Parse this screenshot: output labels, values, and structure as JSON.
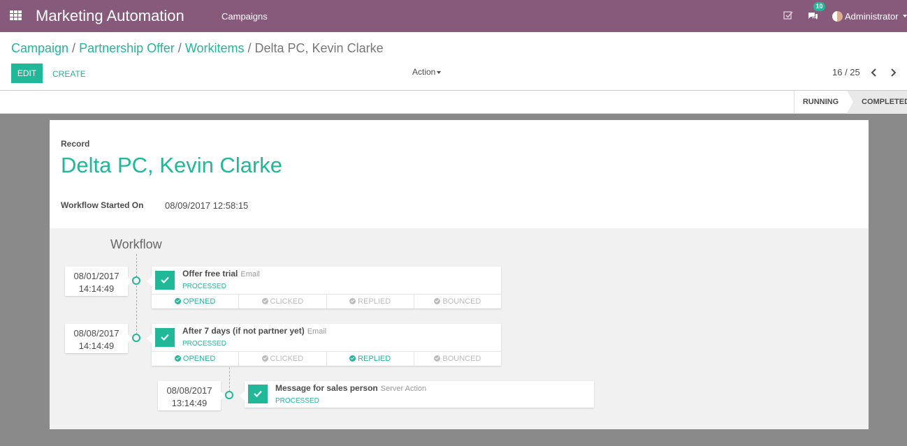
{
  "navbar": {
    "app_title": "Marketing Automation",
    "menu_item": "Campaigns",
    "chat_count": "10",
    "user_name": "Administrator",
    "color": "#875a7b"
  },
  "breadcrumb": {
    "items": [
      "Campaign",
      "Partnership Offer",
      "Workitems"
    ],
    "separator": "/",
    "current": "Delta PC, Kevin Clarke"
  },
  "toolbar": {
    "edit_label": "EDIT",
    "create_label": "CREATE",
    "action_label": "Action"
  },
  "pager": {
    "value": "16 / 25"
  },
  "statusbar": {
    "stages": [
      "RUNNING",
      "COMPLETED"
    ],
    "current": "COMPLETED"
  },
  "record": {
    "label": "Record",
    "title": "Delta PC, Kevin Clarke",
    "started_label": "Workflow Started On",
    "started_value": "08/09/2017 12:58:15"
  },
  "workflow": {
    "heading": "Workflow",
    "steps": [
      {
        "date": "08/01/2017",
        "time": "14:14:49",
        "name": "Offer free trial",
        "type": "Email",
        "status": "PROCESSED",
        "tracking": [
          {
            "label": "OPENED",
            "active": true
          },
          {
            "label": "CLICKED",
            "active": false
          },
          {
            "label": "REPLIED",
            "active": false
          },
          {
            "label": "BOUNCED",
            "active": false
          }
        ]
      },
      {
        "date": "08/08/2017",
        "time": "14:14:49",
        "name": "After 7 days (if not partner yet)",
        "type": "Email",
        "status": "PROCESSED",
        "tracking": [
          {
            "label": "OPENED",
            "active": true
          },
          {
            "label": "CLICKED",
            "active": false
          },
          {
            "label": "REPLIED",
            "active": true
          },
          {
            "label": "BOUNCED",
            "active": false
          }
        ]
      },
      {
        "date": "08/08/2017",
        "time": "13:14:49",
        "name": "Message for sales person",
        "type": "Server Action",
        "status": "PROCESSED"
      }
    ]
  },
  "colors": {
    "accent": "#21b799",
    "brand": "#875a7b"
  }
}
